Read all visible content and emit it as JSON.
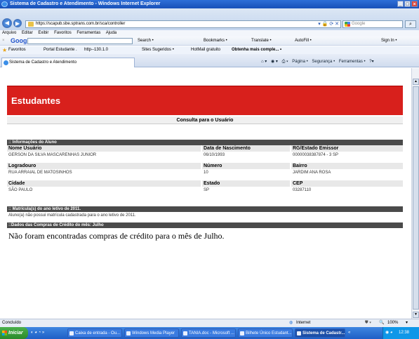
{
  "window": {
    "title": "Sistema de Cadastro e Atendimento - Windows Internet Explorer",
    "min": "_",
    "max": "□",
    "close": "×"
  },
  "nav": {
    "back": "◀",
    "forward": "▶",
    "url": "https://scapub.sbe.sptrans.com.br/sca/controller",
    "search_placeholder": "Google",
    "search_go": "⌕"
  },
  "menu": [
    "Arquivo",
    "Editar",
    "Exibir",
    "Favoritos",
    "Ferramentas",
    "Ajuda"
  ],
  "google_toolbar": {
    "logo": "Google",
    "items": [
      "Search •",
      "Bookmarks •",
      "Translate •",
      "AutoFill •"
    ],
    "sign_in": "Sign In •"
  },
  "favorites": {
    "label": "Favoritos",
    "items": [
      "Portal Estudante .",
      "http--130.1.0",
      "Sites Sugeridos •",
      "HotMail gratuito",
      "Obtenha mais comple... •"
    ]
  },
  "tab": {
    "label": "Sistema de Cadastro e Atendimento"
  },
  "tab_tools": {
    "page": "Página •",
    "security": "Segurança •",
    "tools": "Ferramentas •"
  },
  "page": {
    "banner": "Estudantes",
    "consulta": "Consulta para o Usuário",
    "sec_info": ":: Informações do Aluno",
    "fields": {
      "nome_label": "Nome Usuário",
      "nome_value": "GERSON DA SILVA MASCARENHAS JUNIOR",
      "nasc_label": "Data de Nascimento",
      "nasc_value": "06/10/1993",
      "rg_label": "RG/Estado Emissor",
      "rg_value": "00000038387874 - 3  SP",
      "log_label": "Logradouro",
      "log_value": "RUA ARRAIAL DE MATOSINHOS",
      "num_label": "Número",
      "num_value": "10",
      "bairro_label": "Bairro",
      "bairro_value": "JARDIM ANA ROSA",
      "cidade_label": "Cidade",
      "cidade_value": "SÃO PAULO",
      "estado_label": "Estado",
      "estado_value": "SP",
      "cep_label": "CEP",
      "cep_value": "03287110"
    },
    "sec_matricula": ":: Matrícula(s) do ano letivo de 2011.",
    "matricula_note": "Aluno(a) não possui matrícula cadastrada para o ano letivo de 2011.",
    "sec_compras": "::Dados das Compras de Crédito do mês: Julho",
    "compras_note": "Não foram encontradas compras de crédito para o mês de Julho."
  },
  "status": {
    "left": "Concluído",
    "zone": "Internet",
    "zoom": "100%"
  },
  "taskbar": {
    "start": "Iniciar",
    "buttons": [
      "Caixa de entrada - Ou...",
      "Windows Media Player",
      "TANIA.doc - Microsoft ...",
      "Bilhete Único Estudant...",
      "Sistema de Cadastr..."
    ],
    "clock": "12:38"
  }
}
